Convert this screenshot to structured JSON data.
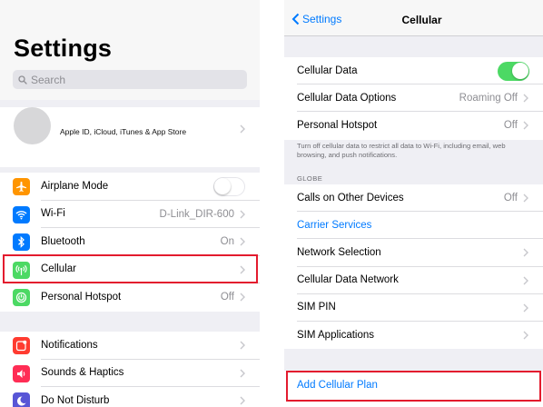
{
  "left": {
    "title": "Settings",
    "search_placeholder": "Search",
    "account_label": "Apple ID, iCloud, iTunes & App Store",
    "group1": [
      {
        "label": "Airplane Mode",
        "value": "",
        "icon": "airplane-icon",
        "color": "#ff9500"
      },
      {
        "label": "Wi-Fi",
        "value": "D-Link_DIR-600",
        "icon": "wifi-icon",
        "color": "#007aff"
      },
      {
        "label": "Bluetooth",
        "value": "On",
        "icon": "bluetooth-icon",
        "color": "#007aff"
      },
      {
        "label": "Cellular",
        "value": "",
        "icon": "cellular-antenna-icon",
        "color": "#4cd964"
      },
      {
        "label": "Personal Hotspot",
        "value": "Off",
        "icon": "hotspot-icon",
        "color": "#4cd964"
      }
    ],
    "group2": [
      {
        "label": "Notifications",
        "icon": "notifications-icon",
        "color": "#ff3b30"
      },
      {
        "label": "Sounds & Haptics",
        "icon": "speaker-icon",
        "color": "#ff2d55"
      },
      {
        "label": "Do Not Disturb",
        "icon": "moon-icon",
        "color": "#5856d6"
      }
    ]
  },
  "right": {
    "back_label": "Settings",
    "title": "Cellular",
    "group1": [
      {
        "label": "Cellular Data",
        "value": ""
      },
      {
        "label": "Cellular Data Options",
        "value": "Roaming Off"
      },
      {
        "label": "Personal Hotspot",
        "value": "Off"
      }
    ],
    "footnote": "Turn off cellular data to restrict all data to Wi-Fi, including email, web browsing, and push notifications.",
    "section_header": "GLOBE",
    "group2": [
      {
        "label": "Calls on Other Devices",
        "value": "Off"
      },
      {
        "label": "Carrier Services",
        "value": ""
      },
      {
        "label": "Network Selection",
        "value": ""
      },
      {
        "label": "Cellular Data Network",
        "value": ""
      },
      {
        "label": "SIM PIN",
        "value": ""
      },
      {
        "label": "SIM Applications",
        "value": ""
      }
    ],
    "add_plan_label": "Add Cellular Plan"
  },
  "colors": {
    "accent": "#007aff",
    "toggle_on": "#4cd964",
    "highlight": "#e31b2e",
    "background": "#efeff4"
  }
}
